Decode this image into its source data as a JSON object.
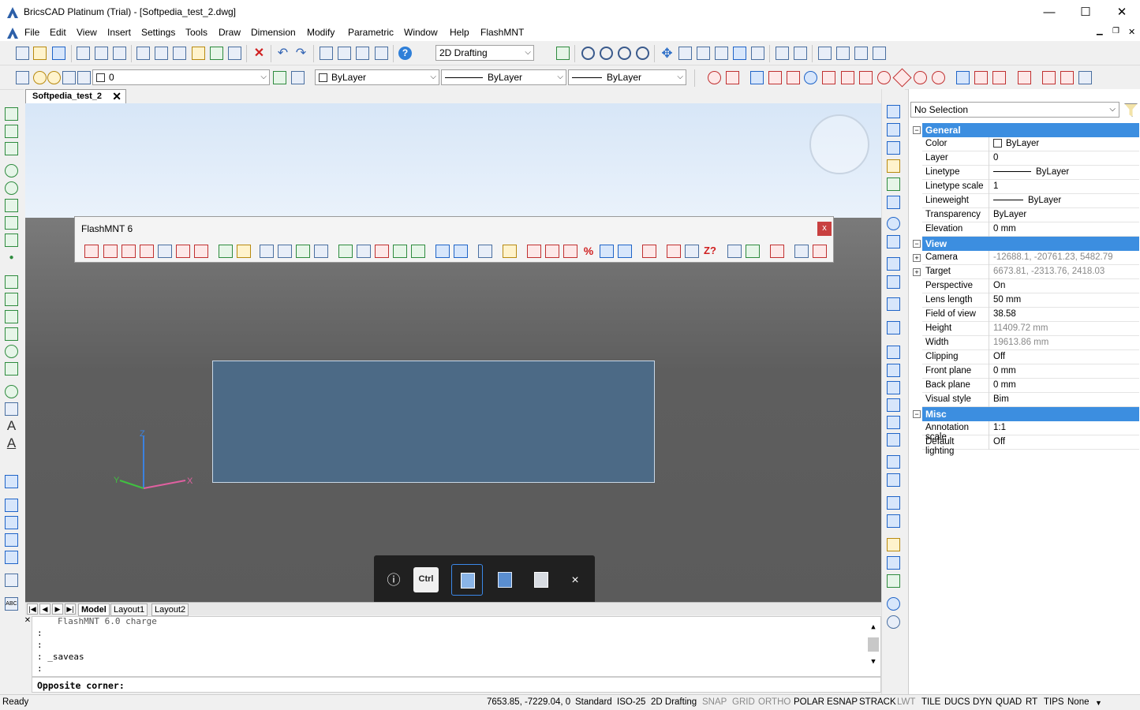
{
  "window": {
    "title": "BricsCAD Platinum (Trial) - [Softpedia_test_2.dwg]",
    "minimize": "—",
    "maximize": "☐",
    "close": "✕"
  },
  "menu": [
    "File",
    "Edit",
    "View",
    "Insert",
    "Settings",
    "Tools",
    "Draw",
    "Dimension",
    "Modify",
    "Parametric",
    "Window",
    "Help",
    "FlashMNT"
  ],
  "toolbar": {
    "workspace": "2D Drafting",
    "layer": "0",
    "color": "ByLayer",
    "linetype": "ByLayer",
    "lineweight": "ByLayer"
  },
  "document_tab": {
    "label": "Softpedia_test_2",
    "close": "✕"
  },
  "flashmnt": {
    "title": "FlashMNT 6",
    "close": "x"
  },
  "ucs": {
    "z": "Z",
    "y": "Y",
    "x": "X"
  },
  "navbar": {
    "info": "ⓘ",
    "ctrl": "Ctrl",
    "close": "×"
  },
  "layout_tabs": [
    "Model",
    "Layout1",
    "Layout2"
  ],
  "command_history": [
    "FlashMNT 6.0 charge",
    ":",
    ":",
    ": _saveas",
    ":"
  ],
  "command_prompt": "Opposite corner:",
  "status": {
    "ready": "Ready",
    "coords": "7653.85, -7229.04, 0",
    "textstyle": "Standard",
    "dimstyle": "ISO-25",
    "workspace": "2D Drafting",
    "toggles": [
      {
        "label": "SNAP",
        "on": false
      },
      {
        "label": "GRID",
        "on": false
      },
      {
        "label": "ORTHO",
        "on": false
      },
      {
        "label": "POLAR",
        "on": true
      },
      {
        "label": "ESNAP",
        "on": true
      },
      {
        "label": "STRACK",
        "on": true
      },
      {
        "label": "LWT",
        "on": false
      },
      {
        "label": "TILE",
        "on": true
      },
      {
        "label": "DUCS",
        "on": true
      },
      {
        "label": "DYN",
        "on": true
      },
      {
        "label": "QUAD",
        "on": true
      },
      {
        "label": "RT",
        "on": true
      },
      {
        "label": "TIPS",
        "on": true
      },
      {
        "label": "None",
        "on": true
      }
    ]
  },
  "properties": {
    "selection": "No Selection",
    "general": {
      "title": "General",
      "rows": [
        {
          "k": "Color",
          "v": "ByLayer"
        },
        {
          "k": "Layer",
          "v": "0"
        },
        {
          "k": "Linetype",
          "v": "ByLayer"
        },
        {
          "k": "Linetype scale",
          "v": "1"
        },
        {
          "k": "Lineweight",
          "v": "ByLayer"
        },
        {
          "k": "Transparency",
          "v": "ByLayer"
        },
        {
          "k": "Elevation",
          "v": "0 mm"
        }
      ]
    },
    "view": {
      "title": "View",
      "rows": [
        {
          "k": "Camera",
          "v": "-12688.1, -20761.23, 5482.79"
        },
        {
          "k": "Target",
          "v": "6673.81, -2313.76, 2418.03"
        },
        {
          "k": "Perspective",
          "v": "On"
        },
        {
          "k": "Lens length",
          "v": "50 mm"
        },
        {
          "k": "Field of view",
          "v": "38.58"
        },
        {
          "k": "Height",
          "v": "11409.72 mm"
        },
        {
          "k": "Width",
          "v": "19613.86 mm"
        },
        {
          "k": "Clipping",
          "v": "Off"
        },
        {
          "k": "Front plane",
          "v": "0 mm"
        },
        {
          "k": "Back plane",
          "v": "0 mm"
        },
        {
          "k": "Visual style",
          "v": "Bim"
        }
      ]
    },
    "misc": {
      "title": "Misc",
      "rows": [
        {
          "k": "Annotation scale",
          "v": "1:1"
        },
        {
          "k": "Default lighting",
          "v": "Off"
        }
      ]
    }
  }
}
